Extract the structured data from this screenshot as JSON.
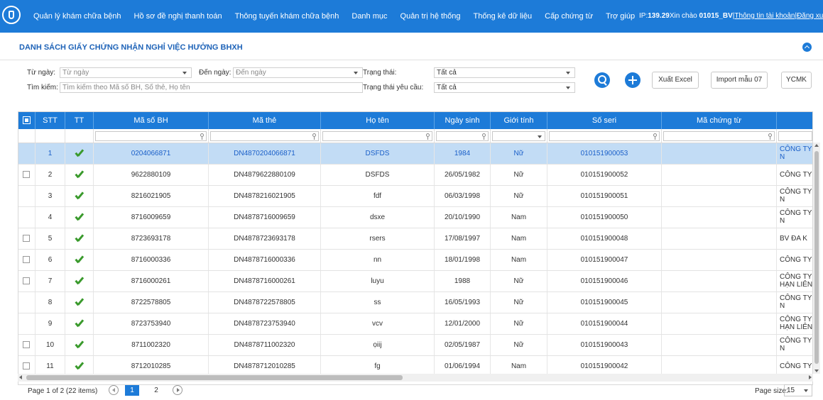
{
  "nav": {
    "items": [
      "Quản lý khám chữa bệnh",
      "Hồ sơ đề nghị thanh toán",
      "Thông tuyến khám chữa bệnh",
      "Danh mục",
      "Quản trị hệ thống",
      "Thống kê dữ liệu",
      "Cấp chứng từ",
      "Trợ giúp"
    ],
    "ip_label": "IP:",
    "ip": "139.29",
    "greeting": "Xin chào ",
    "username": "01015_BV",
    "sep": "|",
    "account_link": "Thông tin tài khoản",
    "logout_link": "Đăng xuất"
  },
  "page": {
    "title": "DANH SÁCH GIẤY CHỨNG NHẬN NGHỈ VIỆC HƯỞNG BHXH"
  },
  "filters": {
    "from_label": "Từ ngày:",
    "from_placeholder": "Từ ngày",
    "to_label": "Đến ngày:",
    "to_placeholder": "Đến ngày",
    "search_label": "Tìm kiếm:",
    "search_placeholder": "Tìm kiếm theo Mã số BH, Số thẻ, Họ tên",
    "status_label": "Trạng thái:",
    "status_value": "Tất cả",
    "req_status_label": "Trạng thái yêu cầu:",
    "req_status_value": "Tất cả"
  },
  "toolbar": {
    "export": "Xuất Excel",
    "import": "Import mẫu 07",
    "ycmk": "YCMK"
  },
  "columns": [
    "STT",
    "TT",
    "Mã số BH",
    "Mã thẻ",
    "Họ tên",
    "Ngày sinh",
    "Giới tính",
    "Số seri",
    "Mã chứng từ"
  ],
  "rows": [
    {
      "stt": "1",
      "bh": "0204066871",
      "the": "DN4870204066871",
      "ten": "DSFDS",
      "ns": "1984",
      "gt": "Nữ",
      "seri": "010151900053",
      "cty": "CÔNG TY",
      "cty2": "N"
    },
    {
      "stt": "2",
      "bh": "9622880109",
      "the": "DN4879622880109",
      "ten": "DSFDS",
      "ns": "26/05/1982",
      "gt": "Nữ",
      "seri": "010151900052",
      "cty": "CÔNG TY",
      "cty2": ""
    },
    {
      "stt": "3",
      "bh": "8216021905",
      "the": "DN4878216021905",
      "ten": "fdf",
      "ns": "06/03/1998",
      "gt": "Nữ",
      "seri": "010151900051",
      "cty": "CÔNG TY",
      "cty2": "N"
    },
    {
      "stt": "4",
      "bh": "8716009659",
      "the": "DN4878716009659",
      "ten": "dsxe",
      "ns": "20/10/1990",
      "gt": "Nam",
      "seri": "010151900050",
      "cty": "CÔNG TY",
      "cty2": "N"
    },
    {
      "stt": "5",
      "bh": "8723693178",
      "the": "DN4878723693178",
      "ten": "rsers",
      "ns": "17/08/1997",
      "gt": "Nam",
      "seri": "010151900048",
      "cty": "BV ĐA K",
      "cty2": ""
    },
    {
      "stt": "6",
      "bh": "8716000336",
      "the": "DN4878716000336",
      "ten": "nn",
      "ns": "18/01/1998",
      "gt": "Nam",
      "seri": "010151900047",
      "cty": "CÔNG TY",
      "cty2": ""
    },
    {
      "stt": "7",
      "bh": "8716000261",
      "the": "DN4878716000261",
      "ten": "luyu",
      "ns": "1988",
      "gt": "Nữ",
      "seri": "010151900046",
      "cty": "CÔNG TY",
      "cty2": "HẠN LIÊN"
    },
    {
      "stt": "8",
      "bh": "8722578805",
      "the": "DN4878722578805",
      "ten": "ss",
      "ns": "16/05/1993",
      "gt": "Nữ",
      "seri": "010151900045",
      "cty": "CÔNG TY",
      "cty2": "N"
    },
    {
      "stt": "9",
      "bh": "8723753940",
      "the": "DN4878723753940",
      "ten": "vcv",
      "ns": "12/01/2000",
      "gt": "Nữ",
      "seri": "010151900044",
      "cty": "CÔNG TY",
      "cty2": "HẠN LIÊN"
    },
    {
      "stt": "10",
      "bh": "8711002320",
      "the": "DN4878711002320",
      "ten": "ọiij",
      "ns": "02/05/1987",
      "gt": "Nữ",
      "seri": "010151900043",
      "cty": "CÔNG TY",
      "cty2": "N"
    },
    {
      "stt": "11",
      "bh": "8712010285",
      "the": "DN4878712010285",
      "ten": "fg",
      "ns": "01/06/1994",
      "gt": "Nam",
      "seri": "010151900042",
      "cty": "CÔNG TY",
      "cty2": ""
    }
  ],
  "pager": {
    "info": "Page 1 of 2 (22 items)",
    "pages": [
      "1",
      "2"
    ],
    "current": "1",
    "size_label": "Page size:",
    "size_value": "15"
  },
  "colors": {
    "primary": "#1d7bd8",
    "selected_row": "#c2dcf5",
    "check": "#3a9a2c",
    "title": "#1e63b8"
  },
  "icons": {
    "logo": "vss-logo-icon",
    "search": "search-icon",
    "add": "plus-icon",
    "check": "check-icon",
    "collapse": "chevron-up-icon"
  }
}
